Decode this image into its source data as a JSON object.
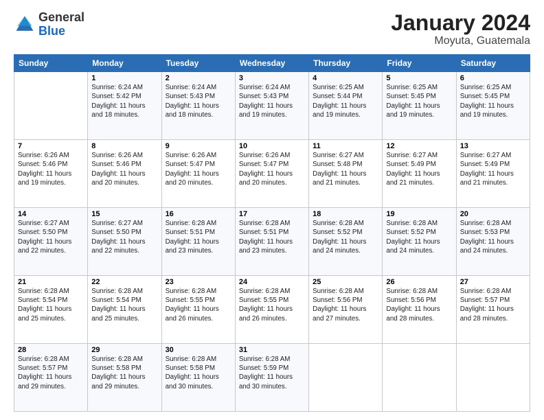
{
  "logo": {
    "general": "General",
    "blue": "Blue"
  },
  "title": "January 2024",
  "location": "Moyuta, Guatemala",
  "days_header": [
    "Sunday",
    "Monday",
    "Tuesday",
    "Wednesday",
    "Thursday",
    "Friday",
    "Saturday"
  ],
  "weeks": [
    [
      {
        "day": "",
        "info": ""
      },
      {
        "day": "1",
        "info": "Sunrise: 6:24 AM\nSunset: 5:42 PM\nDaylight: 11 hours\nand 18 minutes."
      },
      {
        "day": "2",
        "info": "Sunrise: 6:24 AM\nSunset: 5:43 PM\nDaylight: 11 hours\nand 18 minutes."
      },
      {
        "day": "3",
        "info": "Sunrise: 6:24 AM\nSunset: 5:43 PM\nDaylight: 11 hours\nand 19 minutes."
      },
      {
        "day": "4",
        "info": "Sunrise: 6:25 AM\nSunset: 5:44 PM\nDaylight: 11 hours\nand 19 minutes."
      },
      {
        "day": "5",
        "info": "Sunrise: 6:25 AM\nSunset: 5:45 PM\nDaylight: 11 hours\nand 19 minutes."
      },
      {
        "day": "6",
        "info": "Sunrise: 6:25 AM\nSunset: 5:45 PM\nDaylight: 11 hours\nand 19 minutes."
      }
    ],
    [
      {
        "day": "7",
        "info": "Sunrise: 6:26 AM\nSunset: 5:46 PM\nDaylight: 11 hours\nand 19 minutes."
      },
      {
        "day": "8",
        "info": "Sunrise: 6:26 AM\nSunset: 5:46 PM\nDaylight: 11 hours\nand 20 minutes."
      },
      {
        "day": "9",
        "info": "Sunrise: 6:26 AM\nSunset: 5:47 PM\nDaylight: 11 hours\nand 20 minutes."
      },
      {
        "day": "10",
        "info": "Sunrise: 6:26 AM\nSunset: 5:47 PM\nDaylight: 11 hours\nand 20 minutes."
      },
      {
        "day": "11",
        "info": "Sunrise: 6:27 AM\nSunset: 5:48 PM\nDaylight: 11 hours\nand 21 minutes."
      },
      {
        "day": "12",
        "info": "Sunrise: 6:27 AM\nSunset: 5:49 PM\nDaylight: 11 hours\nand 21 minutes."
      },
      {
        "day": "13",
        "info": "Sunrise: 6:27 AM\nSunset: 5:49 PM\nDaylight: 11 hours\nand 21 minutes."
      }
    ],
    [
      {
        "day": "14",
        "info": "Sunrise: 6:27 AM\nSunset: 5:50 PM\nDaylight: 11 hours\nand 22 minutes."
      },
      {
        "day": "15",
        "info": "Sunrise: 6:27 AM\nSunset: 5:50 PM\nDaylight: 11 hours\nand 22 minutes."
      },
      {
        "day": "16",
        "info": "Sunrise: 6:28 AM\nSunset: 5:51 PM\nDaylight: 11 hours\nand 23 minutes."
      },
      {
        "day": "17",
        "info": "Sunrise: 6:28 AM\nSunset: 5:51 PM\nDaylight: 11 hours\nand 23 minutes."
      },
      {
        "day": "18",
        "info": "Sunrise: 6:28 AM\nSunset: 5:52 PM\nDaylight: 11 hours\nand 24 minutes."
      },
      {
        "day": "19",
        "info": "Sunrise: 6:28 AM\nSunset: 5:52 PM\nDaylight: 11 hours\nand 24 minutes."
      },
      {
        "day": "20",
        "info": "Sunrise: 6:28 AM\nSunset: 5:53 PM\nDaylight: 11 hours\nand 24 minutes."
      }
    ],
    [
      {
        "day": "21",
        "info": "Sunrise: 6:28 AM\nSunset: 5:54 PM\nDaylight: 11 hours\nand 25 minutes."
      },
      {
        "day": "22",
        "info": "Sunrise: 6:28 AM\nSunset: 5:54 PM\nDaylight: 11 hours\nand 25 minutes."
      },
      {
        "day": "23",
        "info": "Sunrise: 6:28 AM\nSunset: 5:55 PM\nDaylight: 11 hours\nand 26 minutes."
      },
      {
        "day": "24",
        "info": "Sunrise: 6:28 AM\nSunset: 5:55 PM\nDaylight: 11 hours\nand 26 minutes."
      },
      {
        "day": "25",
        "info": "Sunrise: 6:28 AM\nSunset: 5:56 PM\nDaylight: 11 hours\nand 27 minutes."
      },
      {
        "day": "26",
        "info": "Sunrise: 6:28 AM\nSunset: 5:56 PM\nDaylight: 11 hours\nand 28 minutes."
      },
      {
        "day": "27",
        "info": "Sunrise: 6:28 AM\nSunset: 5:57 PM\nDaylight: 11 hours\nand 28 minutes."
      }
    ],
    [
      {
        "day": "28",
        "info": "Sunrise: 6:28 AM\nSunset: 5:57 PM\nDaylight: 11 hours\nand 29 minutes."
      },
      {
        "day": "29",
        "info": "Sunrise: 6:28 AM\nSunset: 5:58 PM\nDaylight: 11 hours\nand 29 minutes."
      },
      {
        "day": "30",
        "info": "Sunrise: 6:28 AM\nSunset: 5:58 PM\nDaylight: 11 hours\nand 30 minutes."
      },
      {
        "day": "31",
        "info": "Sunrise: 6:28 AM\nSunset: 5:59 PM\nDaylight: 11 hours\nand 30 minutes."
      },
      {
        "day": "",
        "info": ""
      },
      {
        "day": "",
        "info": ""
      },
      {
        "day": "",
        "info": ""
      }
    ]
  ]
}
